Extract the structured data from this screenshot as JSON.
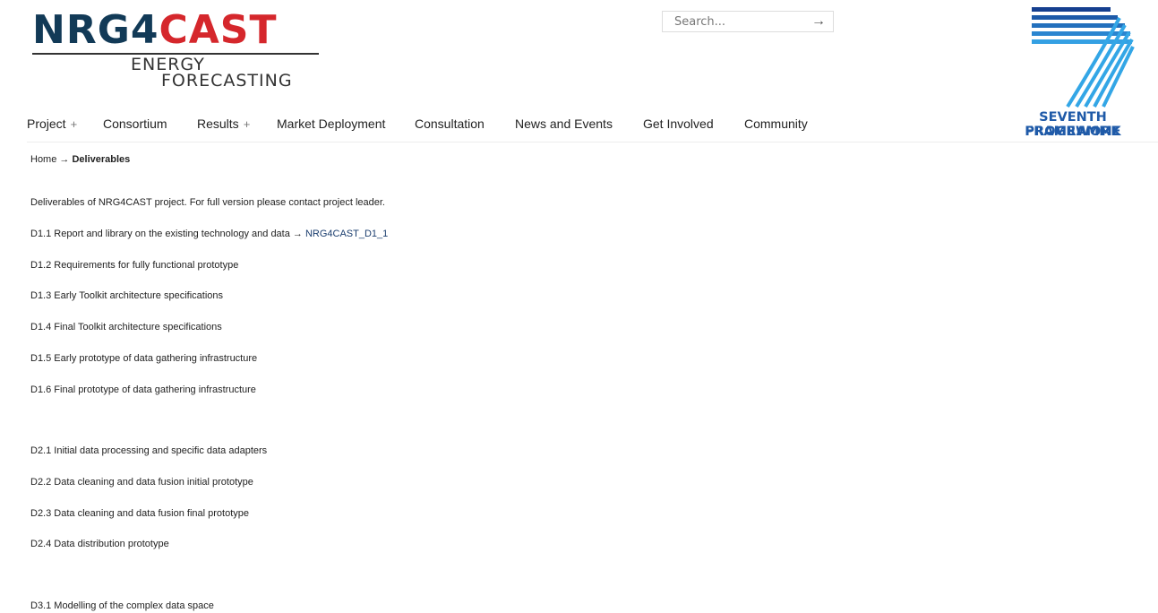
{
  "logo": {
    "part1": "NRG4",
    "part2": "CAST",
    "line1": "ENERGY",
    "line2": "FORECASTING"
  },
  "search": {
    "placeholder": "Search...",
    "button_glyph": "→"
  },
  "fp7": {
    "line1": "SEVENTH FRAMEWORK",
    "line2": "PROGRAMME"
  },
  "nav": {
    "items": [
      {
        "label": "Project",
        "plus": "+"
      },
      {
        "label": "Consortium"
      },
      {
        "label": "Results",
        "plus": "+"
      },
      {
        "label": "Market Deployment"
      },
      {
        "label": "Consultation"
      },
      {
        "label": "News and Events"
      },
      {
        "label": "Get Involved"
      },
      {
        "label": "Community"
      }
    ]
  },
  "breadcrumb": {
    "home": "Home",
    "separator": " → ",
    "current": "Deliverables"
  },
  "content": {
    "intro": "Deliverables of NRG4CAST project. For full version please contact project leader.",
    "d11_text": "D1.1 Report and library on the existing technology and data → ",
    "d11_link": "NRG4CAST_D1_1",
    "d12": "D1.2 Requirements for fully functional prototype",
    "d13": "D1.3 Early Toolkit architecture specifications",
    "d14": "D1.4 Final Toolkit architecture specifications",
    "d15": "D1.5 Early prototype of data gathering infrastructure",
    "d16": "D1.6 Final prototype of data gathering infrastructure",
    "d21": "D2.1 Initial data processing and specific data adapters",
    "d22": "D2.2 Data cleaning and data fusion initial prototype",
    "d23": "D2.3 Data cleaning and data fusion final prototype",
    "d24": "D2.4 Data distribution prototype",
    "d31": "D3.1 Modelling of the complex data space"
  }
}
